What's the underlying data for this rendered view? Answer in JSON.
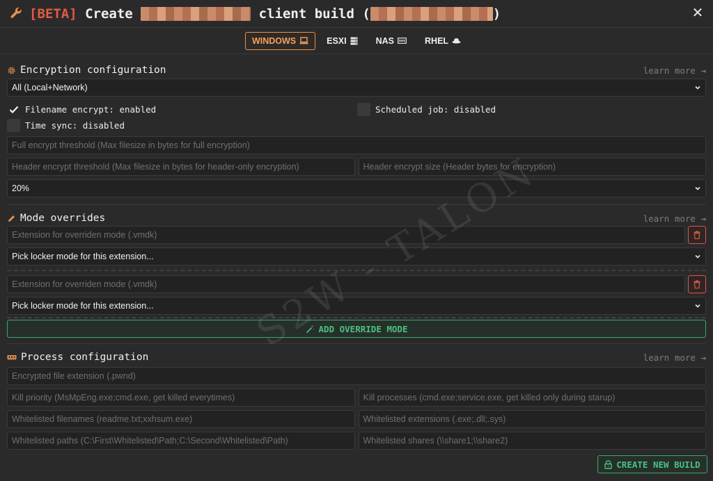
{
  "header": {
    "beta": "[BETA]",
    "create": "Create",
    "client_build": "client build (",
    "close_paren": ")",
    "close_label": "✕"
  },
  "tabs": [
    {
      "label": "WINDOWS",
      "icon": "laptop-icon",
      "active": true
    },
    {
      "label": "ESXI",
      "icon": "server-icon",
      "active": false
    },
    {
      "label": "NAS",
      "icon": "nas-icon",
      "active": false
    },
    {
      "label": "RHEL",
      "icon": "redhat-icon",
      "active": false
    }
  ],
  "encryption": {
    "title": "Encryption configuration",
    "learn_more": "learn more ⇥",
    "mode_select": "All (Local+Network)",
    "filename_encrypt": "Filename encrypt: enabled",
    "scheduled_job": "Scheduled job: disabled",
    "time_sync": "Time sync: disabled",
    "full_threshold_placeholder": "Full encrypt threshold (Max filesize in bytes for full encryption)",
    "header_threshold_placeholder": "Header encrypt threshold (Max filesize in bytes for header-only encryption)",
    "header_size_placeholder": "Header encrypt size (Header bytes for encryption)",
    "percent_select": "20%"
  },
  "mode_overrides": {
    "title": "Mode overrides",
    "learn_more": "learn more ⇥",
    "items": [
      {
        "ext_placeholder": "Extension for overriden mode (.vmdk)",
        "mode_select": "Pick locker mode for this extension..."
      },
      {
        "ext_placeholder": "Extension for overriden mode (.vmdk)",
        "mode_select": "Pick locker mode for this extension..."
      }
    ],
    "add_button": "ADD OVERRIDE MODE"
  },
  "process": {
    "title": "Process configuration",
    "learn_more": "learn more ⇥",
    "ext_placeholder": "Encrypted file extension (.pwnd)",
    "kill_priority_placeholder": "Kill priority (MsMpEng.exe;cmd.exe, get killed everytimes)",
    "kill_processes_placeholder": "Kill processes (cmd.exe;service.exe, get killed only during starup)",
    "wl_filenames_placeholder": "Whitelisted filenames (readme.txt;xxhsum.exe)",
    "wl_extensions_placeholder": "Whitelisted extensions (.exe;.dll;.sys)",
    "wl_paths_placeholder": "Whitelisted paths (C:\\First\\Whitelisted\\Path;C:\\Second\\Whitelisted\\Path)",
    "wl_shares_placeholder": "Whitelisted shares (\\\\share1;\\\\share2)"
  },
  "create_button": "CREATE NEW BUILD",
  "watermark": "S2W - TALON",
  "colors": {
    "accent_orange": "#e7934f",
    "beta_red": "#e25b43",
    "success_green": "#4bc17f",
    "danger_red": "#d95a4a"
  }
}
